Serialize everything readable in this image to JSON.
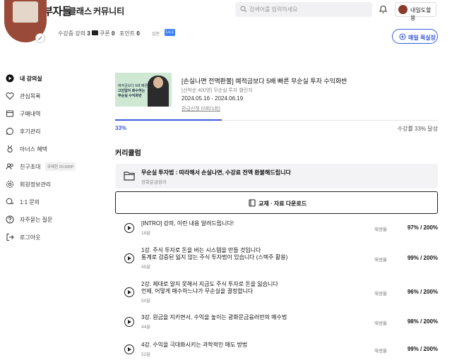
{
  "header": {
    "logo": "월급쟁이부자들",
    "nav": [
      "클래스",
      "커뮤니티"
    ],
    "search_placeholder": "검색어를 입력하세요",
    "user_name": "내일도할용"
  },
  "profile": {
    "stats": [
      {
        "label": "수강중 강의",
        "value": "3"
      },
      {
        "label": "쿠폰",
        "value": "0"
      },
      {
        "label": "포인트",
        "value": "0"
      }
    ],
    "level_label": "입문",
    "level": "Lv.1",
    "check_button": "매일 목실장"
  },
  "sidebar": {
    "items": [
      {
        "label": "내 강의실",
        "icon": "play-circle-icon",
        "active": true
      },
      {
        "label": "관심목록",
        "icon": "heart-icon"
      },
      {
        "label": "구매내역",
        "icon": "receipt-icon"
      },
      {
        "label": "후기관리",
        "icon": "chat-icon"
      },
      {
        "label": "아너스 혜택",
        "icon": "medal-icon"
      },
      {
        "label": "친구초대",
        "icon": "friends-icon",
        "badge": "무제한 20,000P"
      },
      {
        "label": "회원정보관리",
        "icon": "gear-icon"
      },
      {
        "label": "1:1 문의",
        "icon": "chat-bubbles-icon"
      },
      {
        "label": "자주묻는 질문",
        "icon": "question-icon"
      },
      {
        "label": "로그아웃",
        "icon": "logout-icon"
      }
    ]
  },
  "course": {
    "thumb_text": [
      "예적금보다 5배 빠른",
      "고민없이 매수하는",
      "무순실 수익화반"
    ],
    "title": "[손실나면 전액환불] 예적금보다 5배 빠른 무순실 투자 수익화반",
    "subtitle": "[선착순 400명] 무순실 투자 챌린지",
    "date": "2024.05.16 - 2024.06.19",
    "link": "환급신청 (0회/1회)",
    "progress_label": "33%",
    "progress_value": 0.33,
    "progress_text": "수강률 33% 달성"
  },
  "curriculum": {
    "title": "커리큘럼",
    "folder_title": "무순실 투자법 : 따라해서 손실나면, 수강료 전액 환불해드립니다",
    "folder_author": "광화문금융러",
    "download_label": "교재 · 자료 다운로드",
    "replay_label": "재생율",
    "lessons": [
      {
        "title": [
          "[INTRO] 강의, 이런 내용 알려드립니다!"
        ],
        "duration": "18분",
        "rate": "97% / 200%"
      },
      {
        "title": [
          "1강. 주식 투자로 돈을 버는 시스템을 만들 것입니다",
          "통계로 검증된 잃지 않는 주식 투자법이 있습니다 (스텍주 활용)"
        ],
        "duration": "45분",
        "rate": "99% / 200%"
      },
      {
        "title": [
          "2강. 제대로 알지 못해서 지금도 주식 투자로 돈을 잃습니다",
          "언제, 어떻게 매수하느냐가 무순실을 결정합니다"
        ],
        "duration": "50분",
        "rate": "96% / 200%"
      },
      {
        "title": [
          "3강. 원금을 지키면서, 수익을 높이는 광화문금융러만의 매수법"
        ],
        "duration": "44분",
        "rate": "98% / 200%"
      },
      {
        "title": [
          "4강. 수익을 극대화시키는 과학적인 매도 방법"
        ],
        "duration": "52분",
        "rate": "99% / 200%"
      }
    ]
  }
}
